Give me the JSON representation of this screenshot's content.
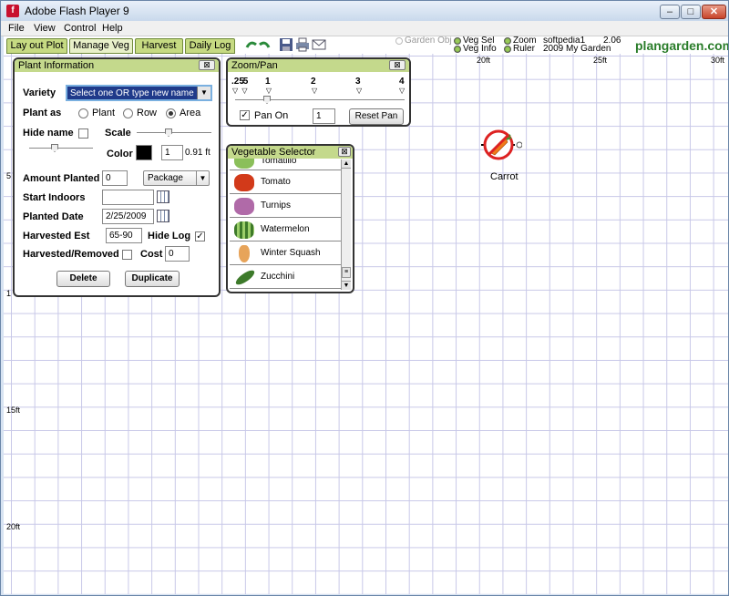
{
  "window": {
    "title": "Adobe Flash Player 9",
    "controls": {
      "minimize": "–",
      "maximize": "□",
      "close": "✕"
    }
  },
  "menu": [
    "File",
    "View",
    "Control",
    "Help"
  ],
  "tabs": [
    "Lay out Plot",
    "Manage Veg",
    "Harvest",
    "Daily Log"
  ],
  "status": {
    "garden_obj": "Garden Obj",
    "veg_sel": "Veg Sel",
    "veg_info": "Veg Info",
    "zoom": "Zoom",
    "ruler": "Ruler",
    "user": "softpedia1",
    "garden_name": "2009 My Garden",
    "version": "2.06",
    "brand": "plangarden.com",
    "brand_colors": {
      "text": "#2a7d2a",
      "dot": "#c8102e"
    }
  },
  "grid": {
    "top_labels": [
      "20ft",
      "25ft",
      "30ft"
    ],
    "left_labels": [
      "5",
      "1",
      "15ft",
      "20ft"
    ]
  },
  "plant_marker": {
    "label": "Carrot",
    "icon": "carrot-icon"
  },
  "plant_info": {
    "title": "Plant Information",
    "variety_label": "Variety",
    "variety_value": "Select one OR type new name",
    "plant_as_label": "Plant as",
    "plant_as_options": [
      "Plant",
      "Row",
      "Area"
    ],
    "plant_as_selected": "Area",
    "hide_name_label": "Hide name",
    "scale_label": "Scale",
    "color_label": "Color",
    "color_swatch": "#000000",
    "scale_value": "1",
    "scale_unit": "0.91 ft",
    "amount_planted_label": "Amount Planted",
    "amount_planted_value": "0",
    "amount_unit": "Package",
    "start_indoors_label": "Start Indoors",
    "start_indoors_value": "",
    "planted_date_label": "Planted Date",
    "planted_date_value": "2/25/2009",
    "harvested_est_label": "Harvested Est",
    "harvested_est_value": "65-90",
    "hide_log_label": "Hide Log",
    "hide_log_checked": true,
    "harvested_removed_label": "Harvested/Removed",
    "cost_label": "Cost",
    "cost_value": "0",
    "delete_label": "Delete",
    "duplicate_label": "Duplicate"
  },
  "zoom_pan": {
    "title": "Zoom/Pan",
    "ticks": [
      ".25",
      ".5",
      "1",
      "2",
      "3",
      "4"
    ],
    "pan_on_label": "Pan On",
    "pan_on_checked": true,
    "pan_value": "1",
    "reset_label": "Reset Pan"
  },
  "veg_selector": {
    "title": "Vegetable Selector",
    "items": [
      {
        "name": "Tomatillo",
        "color": "#8bbf5a"
      },
      {
        "name": "Tomato",
        "color": "#d23a1a"
      },
      {
        "name": "Turnips",
        "color": "#b06aa8"
      },
      {
        "name": "Watermelon",
        "color": "#5e9a3a"
      },
      {
        "name": "Winter Squash",
        "color": "#e7a45a"
      },
      {
        "name": "Zucchini",
        "color": "#3d7a2a"
      }
    ]
  }
}
